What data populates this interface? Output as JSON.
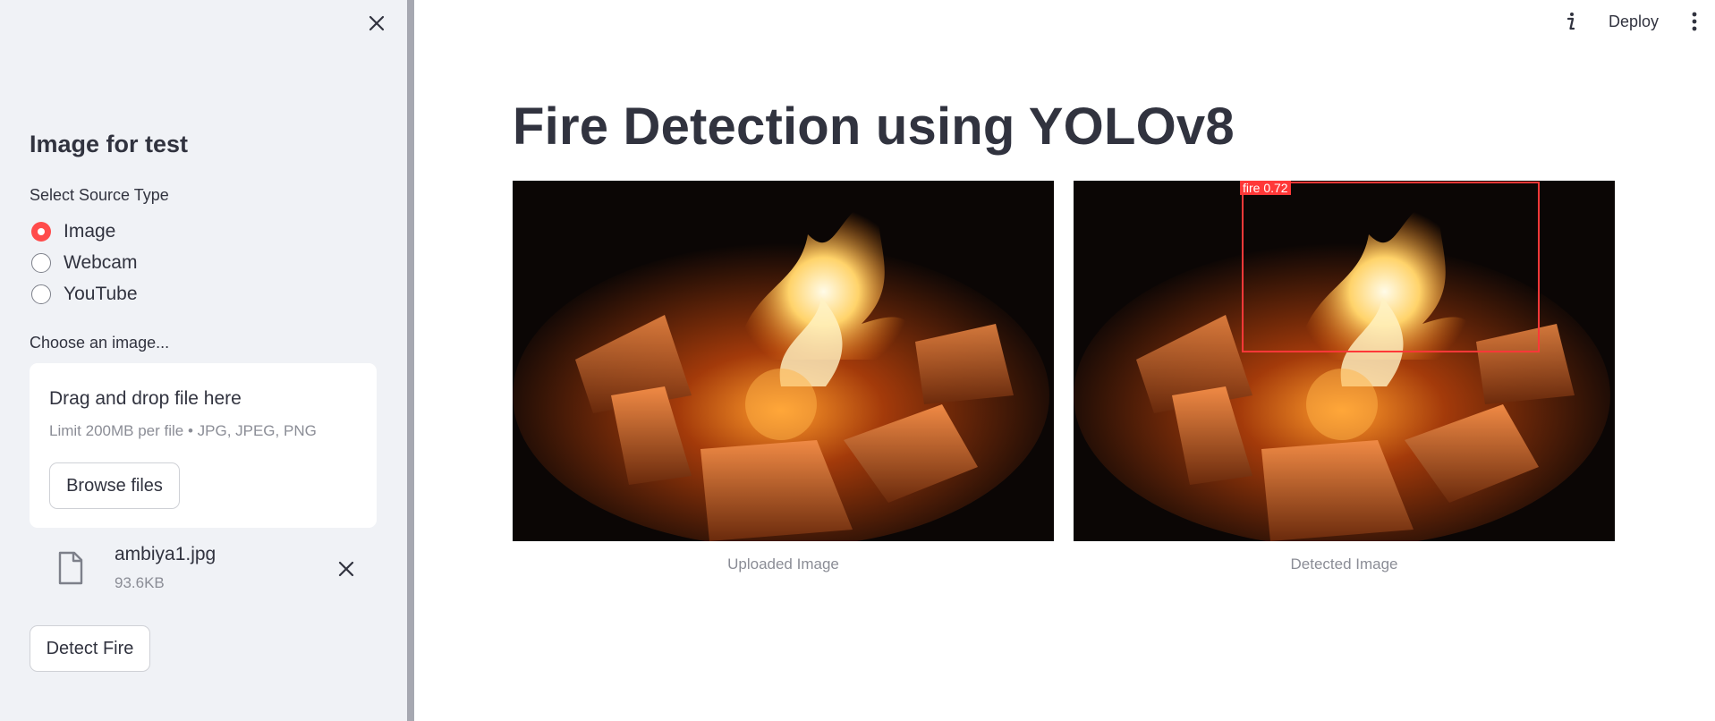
{
  "app": {
    "topbar": {
      "deploy_label": "Deploy",
      "info_icon": "info-icon",
      "menu_icon": "kebab-menu-icon"
    }
  },
  "sidebar": {
    "close_icon": "close-icon",
    "heading": "Image for test",
    "source_label": "Select Source Type",
    "source_options": [
      {
        "label": "Image",
        "checked": true
      },
      {
        "label": "Webcam",
        "checked": false
      },
      {
        "label": "YouTube",
        "checked": false
      }
    ],
    "uploader_label": "Choose an image...",
    "dropzone": {
      "title": "Drag and drop file here",
      "limit": "Limit 200MB per file • JPG, JPEG, PNG",
      "browse_label": "Browse files"
    },
    "file": {
      "name": "ambiya1.jpg",
      "size": "93.6KB",
      "icon": "file-icon"
    },
    "detect_label": "Detect Fire"
  },
  "main": {
    "title": "Fire Detection using YOLOv8",
    "uploaded_caption": "Uploaded Image",
    "detected_caption": "Detected Image",
    "detection": {
      "label": "fire",
      "confidence": "0.72",
      "text": "fire  0.72"
    }
  },
  "colors": {
    "accent": "#ff4b4b",
    "sidebar_bg": "#f0f2f6",
    "box": "#ff3838",
    "text": "#31333f",
    "muted": "#8b8d96"
  }
}
